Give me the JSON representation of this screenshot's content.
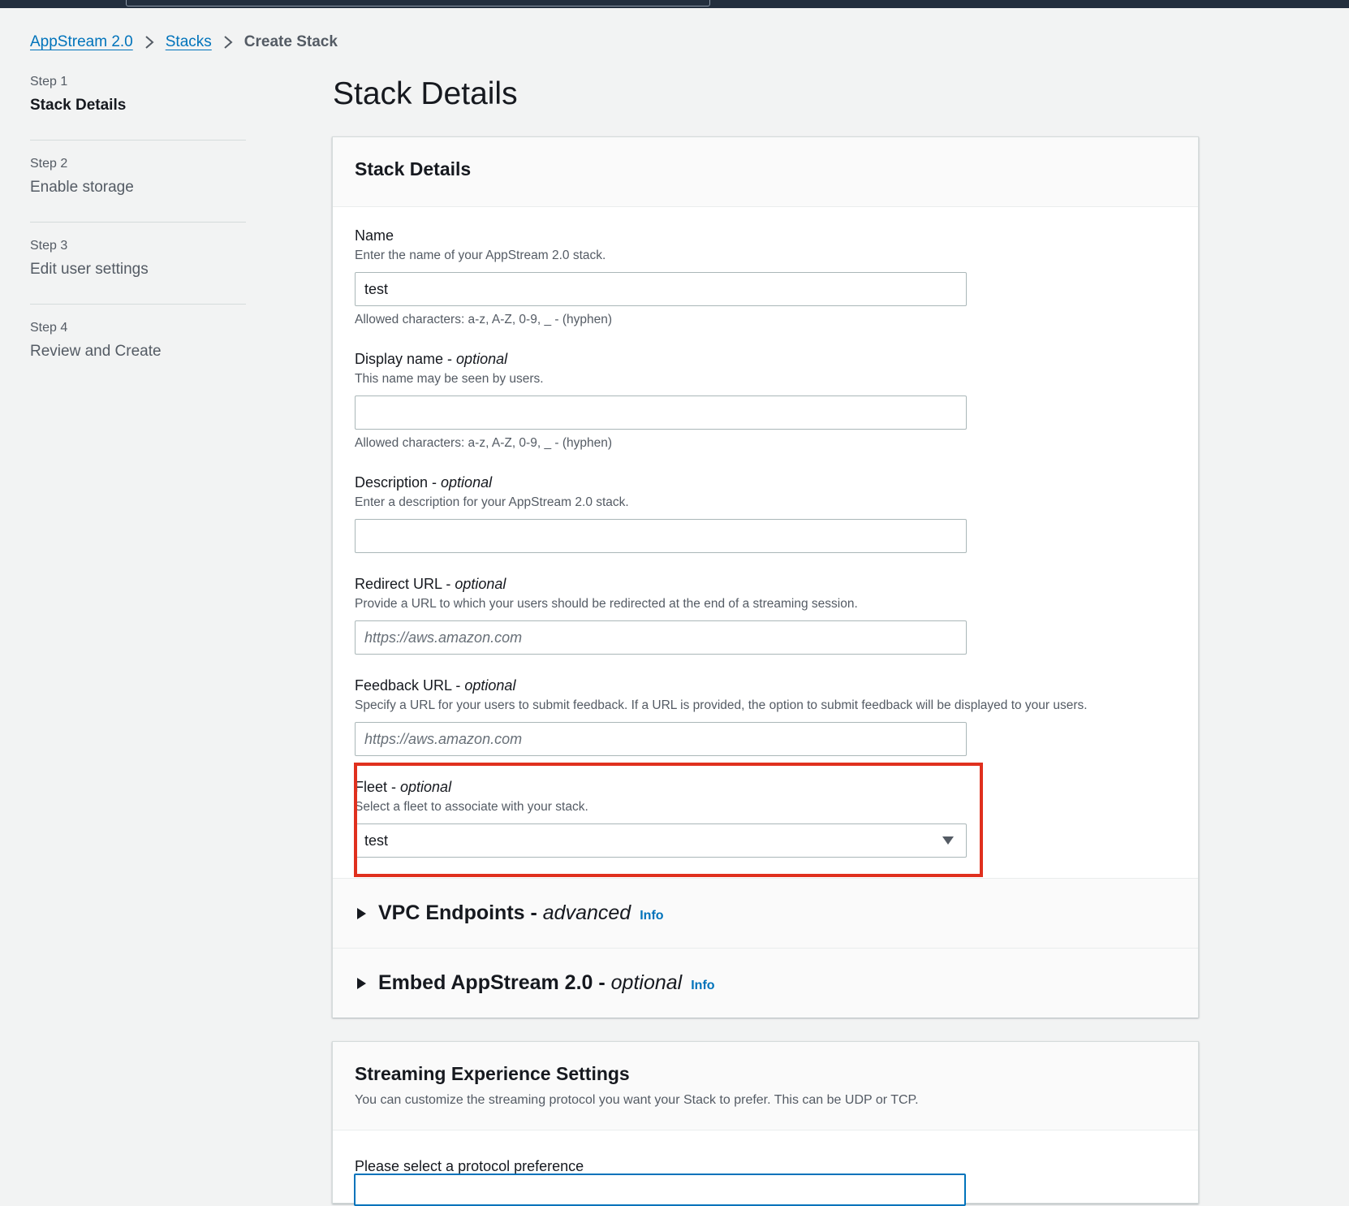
{
  "breadcrumb": {
    "items": [
      "AppStream 2.0",
      "Stacks"
    ],
    "current": "Create Stack"
  },
  "steps": [
    {
      "num": "Step 1",
      "title": "Stack Details"
    },
    {
      "num": "Step 2",
      "title": "Enable storage"
    },
    {
      "num": "Step 3",
      "title": "Edit user settings"
    },
    {
      "num": "Step 4",
      "title": "Review and Create"
    }
  ],
  "page_title": "Stack Details",
  "panel": {
    "title": "Stack Details",
    "name": {
      "label": "Name",
      "desc": "Enter the name of your AppStream 2.0 stack.",
      "value": "test",
      "hint": "Allowed characters: a-z, A-Z, 0-9, _ - (hyphen)"
    },
    "display_name": {
      "label": "Display name - ",
      "optional": "optional",
      "desc": "This name may be seen by users.",
      "value": "",
      "hint": "Allowed characters: a-z, A-Z, 0-9, _ - (hyphen)"
    },
    "description": {
      "label": "Description - ",
      "optional": "optional",
      "desc": "Enter a description for your AppStream 2.0 stack.",
      "value": ""
    },
    "redirect_url": {
      "label": "Redirect URL - ",
      "optional": "optional",
      "desc": "Provide a URL to which your users should be redirected at the end of a streaming session.",
      "placeholder": "https://aws.amazon.com"
    },
    "feedback_url": {
      "label": "Feedback URL - ",
      "optional": "optional",
      "desc": "Specify a URL for your users to submit feedback. If a URL is provided, the option to submit feedback will be displayed to your users.",
      "placeholder": "https://aws.amazon.com"
    },
    "fleet": {
      "label": "Fleet - ",
      "optional": "optional",
      "desc": "Select a fleet to associate with your stack.",
      "selected": "test"
    },
    "vpc": {
      "title": "VPC Endpoints - ",
      "suffix": "advanced",
      "info": "Info"
    },
    "embed": {
      "title": "Embed AppStream 2.0 - ",
      "suffix": "optional",
      "info": "Info"
    }
  },
  "streaming": {
    "title": "Streaming Experience Settings",
    "desc": "You can customize the streaming protocol you want your Stack to prefer. This can be UDP or TCP.",
    "protocol_label": "Please select a protocol preference"
  },
  "colors": {
    "link": "#0073bb",
    "highlight": "#e0301e",
    "topbar": "#232f3e"
  }
}
